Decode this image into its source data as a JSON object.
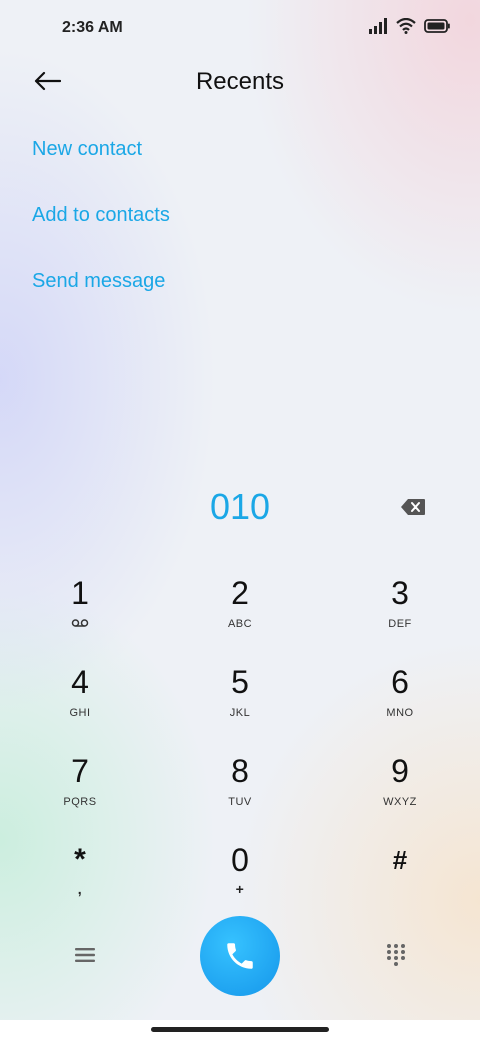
{
  "status_bar": {
    "time": "2:36 AM",
    "icons": [
      "signal-icon",
      "wifi-icon",
      "battery-icon"
    ]
  },
  "header": {
    "back_icon": "back-arrow-icon",
    "title": "Recents"
  },
  "actions": [
    {
      "label": "New contact"
    },
    {
      "label": "Add to contacts"
    },
    {
      "label": "Send message"
    }
  ],
  "dialer": {
    "number": "010",
    "delete_icon": "backspace-icon"
  },
  "keypad": [
    {
      "digit": "1",
      "letters": "",
      "icon": "voicemail-icon"
    },
    {
      "digit": "2",
      "letters": "ABC"
    },
    {
      "digit": "3",
      "letters": "DEF"
    },
    {
      "digit": "4",
      "letters": "GHI"
    },
    {
      "digit": "5",
      "letters": "JKL"
    },
    {
      "digit": "6",
      "letters": "MNO"
    },
    {
      "digit": "7",
      "letters": "PQRS"
    },
    {
      "digit": "8",
      "letters": "TUV"
    },
    {
      "digit": "9",
      "letters": "WXYZ"
    },
    {
      "digit": "*",
      "letters": ","
    },
    {
      "digit": "0",
      "letters": "+"
    },
    {
      "digit": "#",
      "letters": ""
    }
  ],
  "bottom_bar": {
    "menu_icon": "menu-icon",
    "call_icon": "phone-icon",
    "dialpad_icon": "dialpad-icon"
  },
  "colors": {
    "accent": "#1aa7e6",
    "call_button": "#1596ea"
  }
}
